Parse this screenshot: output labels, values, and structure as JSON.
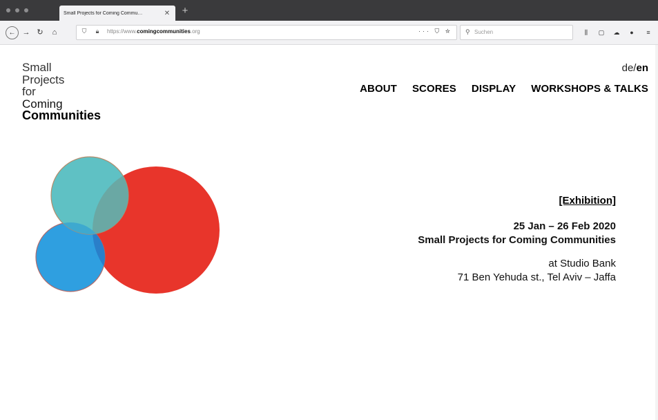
{
  "browser": {
    "tab_title": "Small Projects for Coming Commu…",
    "tab_close": "✕",
    "new_tab": "+",
    "url_prefix": "https://www.",
    "url_domain": "comingcommunities",
    "url_suffix": ".org",
    "url_actions": "··· ⛉ ☆",
    "search_placeholder": "Suchen"
  },
  "site": {
    "logo_lines": [
      "Small",
      "Projects",
      "for",
      "Coming",
      "Communities"
    ],
    "lang_prefix": "de/",
    "lang_active": "en",
    "nav": [
      "ABOUT",
      "SCORES",
      "DISPLAY",
      "WORKSHOPS & TALKS"
    ]
  },
  "event": {
    "type": "[Exhibition]",
    "dates": "25 Jan – 26 Feb 2020",
    "title": "Small Projects for Coming Communities",
    "venue": "at Studio Bank",
    "address": "71 Ben Yehuda st., Tel Aviv – Jaffa"
  },
  "colors": {
    "red_circle": "#e8352b",
    "teal_circle": "#5fc1c4",
    "blue_circle": "#2f9fe0",
    "overlap": "#6aa8a4"
  }
}
